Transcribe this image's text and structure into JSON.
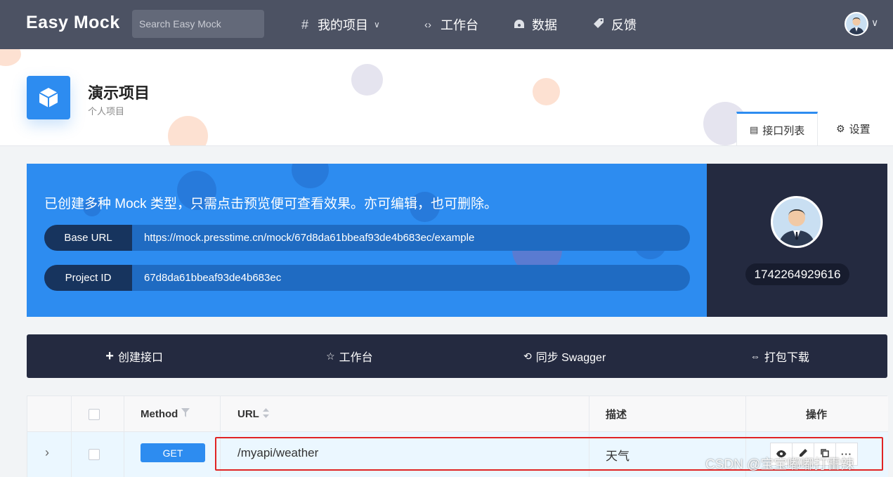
{
  "topnav": {
    "logo": "Easy Mock",
    "search_placeholder": "Search Easy Mock",
    "items": [
      {
        "icon": "hash-icon",
        "label": "我的项目"
      },
      {
        "icon": "code-arrows-icon",
        "label": "工作台"
      },
      {
        "icon": "dashboard-icon",
        "label": "数据"
      },
      {
        "icon": "tag-icon",
        "label": "反馈"
      }
    ]
  },
  "project": {
    "title": "演示项目",
    "subtitle": "个人项目",
    "tabs": [
      {
        "label": "接口列表",
        "icon": "list-icon",
        "active": true
      },
      {
        "label": "设置",
        "icon": "gear-icon",
        "active": false
      }
    ]
  },
  "banner": {
    "message": "已创建多种 Mock 类型，只需点击预览便可查看效果。亦可编辑，也可删除。",
    "base_url_label": "Base URL",
    "base_url": "https://mock.presstime.cn/mock/67d8da61bbeaf93de4b683ec/example",
    "project_id_label": "Project ID",
    "project_id": "67d8da61bbeaf93de4b683ec"
  },
  "user": {
    "id": "1742264929616"
  },
  "actions": [
    {
      "icon": "plus-icon",
      "glyph": "+",
      "label": "创建接口"
    },
    {
      "icon": "star-icon",
      "glyph": "☆",
      "label": "工作台"
    },
    {
      "icon": "sync-icon",
      "glyph": "⟲",
      "label": "同步 Swagger"
    },
    {
      "icon": "download-icon",
      "glyph": "⇔",
      "label": "打包下载"
    }
  ],
  "table": {
    "headers": {
      "method": "Method",
      "url": "URL",
      "desc": "描述",
      "ops": "操作"
    },
    "rows": [
      {
        "method": "GET",
        "url": "/myapi/weather",
        "desc": "天气"
      }
    ]
  },
  "watermark": "CSDN @宝宝嘟嘟打雷辣",
  "colors": {
    "primary": "#2d8cf0",
    "nav": "#4c5263",
    "dark": "#242a40",
    "highlight": "#e02424"
  }
}
